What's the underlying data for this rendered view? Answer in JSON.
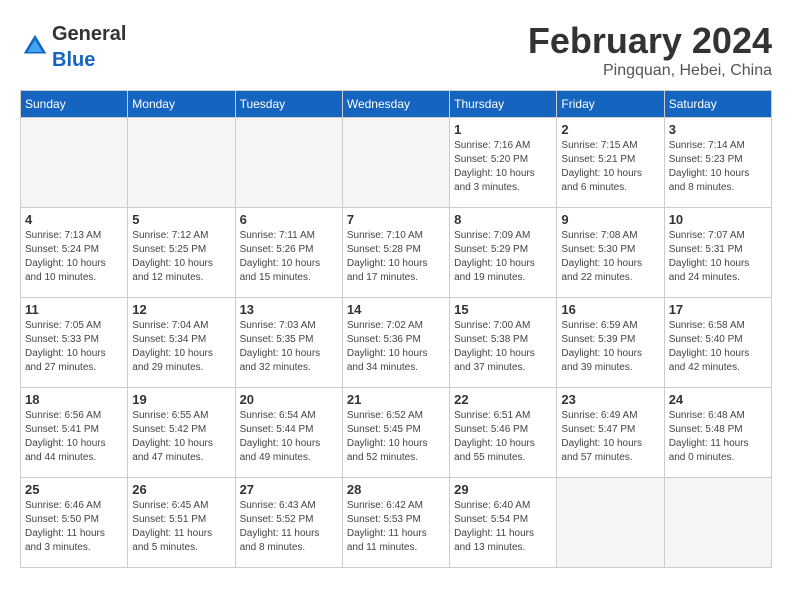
{
  "logo": {
    "general": "General",
    "blue": "Blue"
  },
  "title": {
    "month_year": "February 2024",
    "location": "Pingquan, Hebei, China"
  },
  "headers": [
    "Sunday",
    "Monday",
    "Tuesday",
    "Wednesday",
    "Thursday",
    "Friday",
    "Saturday"
  ],
  "weeks": [
    [
      {
        "day": "",
        "info": ""
      },
      {
        "day": "",
        "info": ""
      },
      {
        "day": "",
        "info": ""
      },
      {
        "day": "",
        "info": ""
      },
      {
        "day": "1",
        "info": "Sunrise: 7:16 AM\nSunset: 5:20 PM\nDaylight: 10 hours\nand 3 minutes."
      },
      {
        "day": "2",
        "info": "Sunrise: 7:15 AM\nSunset: 5:21 PM\nDaylight: 10 hours\nand 6 minutes."
      },
      {
        "day": "3",
        "info": "Sunrise: 7:14 AM\nSunset: 5:23 PM\nDaylight: 10 hours\nand 8 minutes."
      }
    ],
    [
      {
        "day": "4",
        "info": "Sunrise: 7:13 AM\nSunset: 5:24 PM\nDaylight: 10 hours\nand 10 minutes."
      },
      {
        "day": "5",
        "info": "Sunrise: 7:12 AM\nSunset: 5:25 PM\nDaylight: 10 hours\nand 12 minutes."
      },
      {
        "day": "6",
        "info": "Sunrise: 7:11 AM\nSunset: 5:26 PM\nDaylight: 10 hours\nand 15 minutes."
      },
      {
        "day": "7",
        "info": "Sunrise: 7:10 AM\nSunset: 5:28 PM\nDaylight: 10 hours\nand 17 minutes."
      },
      {
        "day": "8",
        "info": "Sunrise: 7:09 AM\nSunset: 5:29 PM\nDaylight: 10 hours\nand 19 minutes."
      },
      {
        "day": "9",
        "info": "Sunrise: 7:08 AM\nSunset: 5:30 PM\nDaylight: 10 hours\nand 22 minutes."
      },
      {
        "day": "10",
        "info": "Sunrise: 7:07 AM\nSunset: 5:31 PM\nDaylight: 10 hours\nand 24 minutes."
      }
    ],
    [
      {
        "day": "11",
        "info": "Sunrise: 7:05 AM\nSunset: 5:33 PM\nDaylight: 10 hours\nand 27 minutes."
      },
      {
        "day": "12",
        "info": "Sunrise: 7:04 AM\nSunset: 5:34 PM\nDaylight: 10 hours\nand 29 minutes."
      },
      {
        "day": "13",
        "info": "Sunrise: 7:03 AM\nSunset: 5:35 PM\nDaylight: 10 hours\nand 32 minutes."
      },
      {
        "day": "14",
        "info": "Sunrise: 7:02 AM\nSunset: 5:36 PM\nDaylight: 10 hours\nand 34 minutes."
      },
      {
        "day": "15",
        "info": "Sunrise: 7:00 AM\nSunset: 5:38 PM\nDaylight: 10 hours\nand 37 minutes."
      },
      {
        "day": "16",
        "info": "Sunrise: 6:59 AM\nSunset: 5:39 PM\nDaylight: 10 hours\nand 39 minutes."
      },
      {
        "day": "17",
        "info": "Sunrise: 6:58 AM\nSunset: 5:40 PM\nDaylight: 10 hours\nand 42 minutes."
      }
    ],
    [
      {
        "day": "18",
        "info": "Sunrise: 6:56 AM\nSunset: 5:41 PM\nDaylight: 10 hours\nand 44 minutes."
      },
      {
        "day": "19",
        "info": "Sunrise: 6:55 AM\nSunset: 5:42 PM\nDaylight: 10 hours\nand 47 minutes."
      },
      {
        "day": "20",
        "info": "Sunrise: 6:54 AM\nSunset: 5:44 PM\nDaylight: 10 hours\nand 49 minutes."
      },
      {
        "day": "21",
        "info": "Sunrise: 6:52 AM\nSunset: 5:45 PM\nDaylight: 10 hours\nand 52 minutes."
      },
      {
        "day": "22",
        "info": "Sunrise: 6:51 AM\nSunset: 5:46 PM\nDaylight: 10 hours\nand 55 minutes."
      },
      {
        "day": "23",
        "info": "Sunrise: 6:49 AM\nSunset: 5:47 PM\nDaylight: 10 hours\nand 57 minutes."
      },
      {
        "day": "24",
        "info": "Sunrise: 6:48 AM\nSunset: 5:48 PM\nDaylight: 11 hours\nand 0 minutes."
      }
    ],
    [
      {
        "day": "25",
        "info": "Sunrise: 6:46 AM\nSunset: 5:50 PM\nDaylight: 11 hours\nand 3 minutes."
      },
      {
        "day": "26",
        "info": "Sunrise: 6:45 AM\nSunset: 5:51 PM\nDaylight: 11 hours\nand 5 minutes."
      },
      {
        "day": "27",
        "info": "Sunrise: 6:43 AM\nSunset: 5:52 PM\nDaylight: 11 hours\nand 8 minutes."
      },
      {
        "day": "28",
        "info": "Sunrise: 6:42 AM\nSunset: 5:53 PM\nDaylight: 11 hours\nand 11 minutes."
      },
      {
        "day": "29",
        "info": "Sunrise: 6:40 AM\nSunset: 5:54 PM\nDaylight: 11 hours\nand 13 minutes."
      },
      {
        "day": "",
        "info": ""
      },
      {
        "day": "",
        "info": ""
      }
    ]
  ]
}
